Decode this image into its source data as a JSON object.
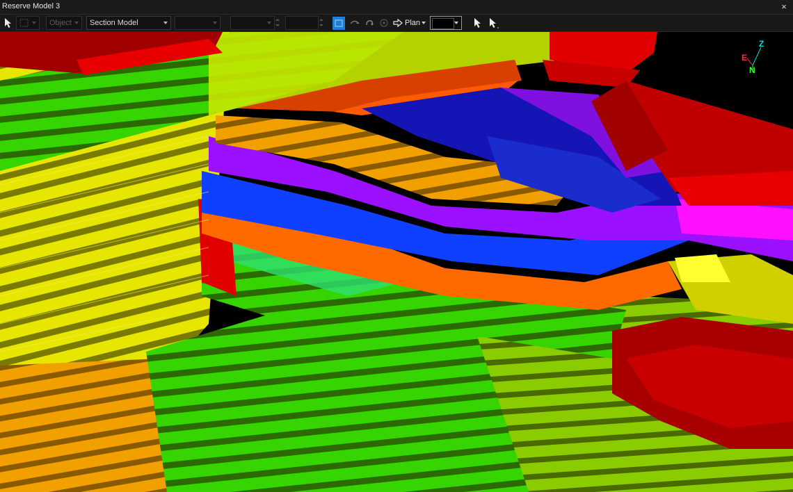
{
  "window": {
    "title": "Reserve Model 3",
    "close_glyph": "×"
  },
  "toolbar": {
    "object_dropdown": {
      "placeholder": "Object"
    },
    "section_dropdown": {
      "value": "Section Model"
    },
    "plan_button": {
      "label": "Plan"
    },
    "colors": {
      "active_button": "#1f7fd6",
      "swatch": "#000000"
    }
  },
  "view": {
    "axes": {
      "z_label": "Z",
      "e_label": "E",
      "n_label": "N"
    },
    "colors": {
      "background": "#000000",
      "red": "#e00000",
      "orange": "#ff7a00",
      "yellow": "#ffff00",
      "green": "#22dd00",
      "blue": "#1030ff",
      "purple": "#9000ff",
      "magenta": "#ff00ff"
    }
  }
}
